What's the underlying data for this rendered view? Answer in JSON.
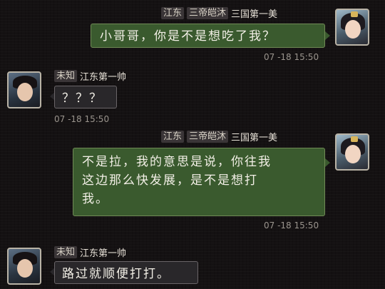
{
  "messages": [
    {
      "side": "right",
      "tags": [
        "江东",
        "三帝皑沐"
      ],
      "name": "三国第一美",
      "text": "小哥哥，你是不是想吃了我？",
      "time": "07 -18 15:50",
      "avatar": "female-portrait"
    },
    {
      "side": "left",
      "tags": [
        "未知"
      ],
      "name": "江东第一帅",
      "text": "？？？",
      "time": "07 -18 15:50",
      "avatar": "male-portrait"
    },
    {
      "side": "right",
      "tags": [
        "江东",
        "三帝皑沐"
      ],
      "name": "三国第一美",
      "text_lines": [
        "不是拉，我的意思是说，你往我",
        "这边那么快发展，是不是想打",
        "我。"
      ],
      "time": "07 -18 15:50",
      "avatar": "female-portrait"
    },
    {
      "side": "left",
      "tags": [
        "未知"
      ],
      "name": "江东第一帅",
      "text": "路过就顺便打打。",
      "avatar": "male-portrait"
    }
  ],
  "colors": {
    "background": "#141112",
    "bubble_green": "#3a5a2e",
    "bubble_dark": "#29272a",
    "timestamp": "#9a948d"
  }
}
